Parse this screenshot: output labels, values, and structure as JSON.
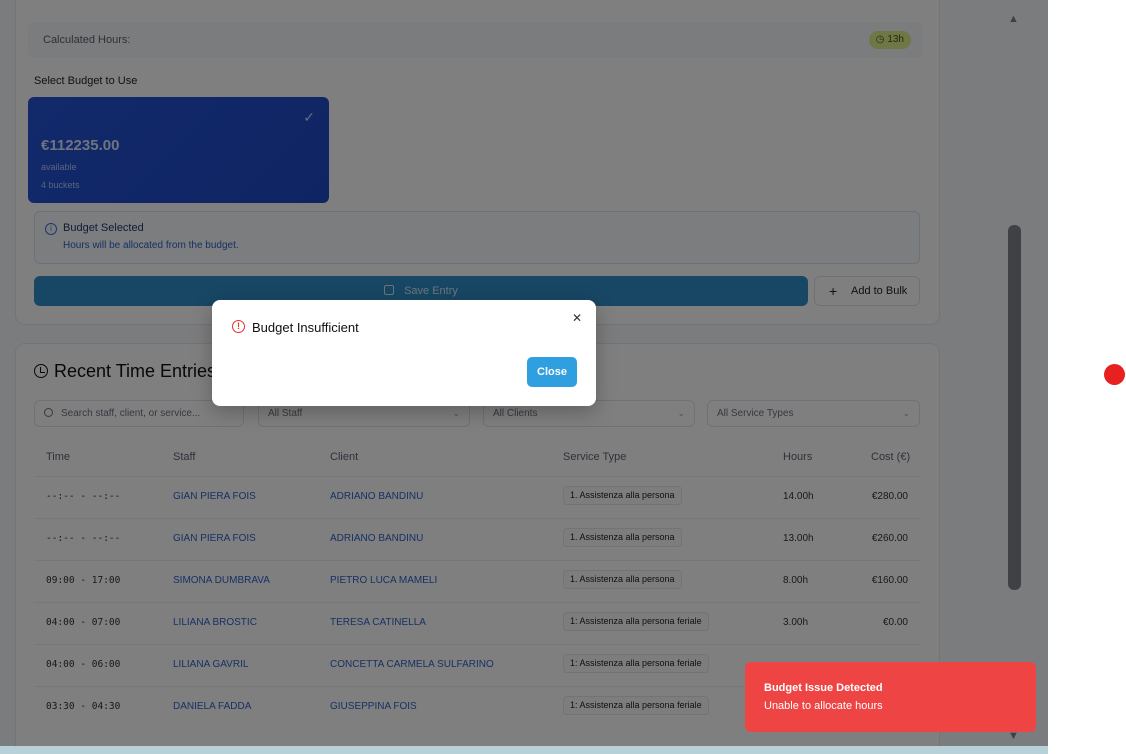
{
  "form": {
    "calculated_hours_label": "Calculated Hours:",
    "calculated_hours_value": "13h",
    "select_budget_label": "Select Budget to Use",
    "budget": {
      "amount": "€112235.00",
      "available": "available",
      "buckets": "4 buckets"
    },
    "info": {
      "title": "Budget Selected",
      "subtitle": "Hours will be allocated from the budget."
    },
    "save_label": "Save Entry",
    "bulk_label": "Add to Bulk"
  },
  "entries": {
    "title": "Recent Time Entries",
    "search_placeholder": "Search staff, client, or service...",
    "filters": {
      "staff": "All Staff",
      "clients": "All Clients",
      "service_types": "All Service Types"
    },
    "columns": {
      "time": "Time",
      "staff": "Staff",
      "client": "Client",
      "service": "Service Type",
      "hours": "Hours",
      "cost": "Cost (€)"
    },
    "rows": [
      {
        "time": "--:-- - --:--",
        "staff": "GIAN PIERA FOIS",
        "client": "ADRIANO BANDINU",
        "service": "1. Assistenza alla persona",
        "hours": "14.00h",
        "cost": "€280.00"
      },
      {
        "time": "--:-- - --:--",
        "staff": "GIAN PIERA FOIS",
        "client": "ADRIANO BANDINU",
        "service": "1. Assistenza alla persona",
        "hours": "13.00h",
        "cost": "€260.00"
      },
      {
        "time": "09:00 - 17:00",
        "staff": "SIMONA DUMBRAVA",
        "client": "PIETRO LUCA MAMELI",
        "service": "1. Assistenza alla persona",
        "hours": "8.00h",
        "cost": "€160.00"
      },
      {
        "time": "04:00 - 07:00",
        "staff": "LILIANA BROSTIC",
        "client": "TERESA CATINELLA",
        "service": "1: Assistenza alla persona feriale",
        "hours": "3.00h",
        "cost": "€0.00"
      },
      {
        "time": "04:00 - 06:00",
        "staff": "LILIANA GAVRIL",
        "client": "CONCETTA CARMELA SULFARINO",
        "service": "1: Assistenza alla persona feriale",
        "hours": "",
        "cost": ""
      },
      {
        "time": "03:30 - 04:30",
        "staff": "DANIELA FADDA",
        "client": "GIUSEPPINA FOIS",
        "service": "1: Assistenza alla persona feriale",
        "hours": "",
        "cost": ""
      }
    ]
  },
  "dialog": {
    "title": "Budget Insufficient",
    "close_label": "Close"
  },
  "toast": {
    "title": "Budget Issue Detected",
    "message": "Unable to allocate hours"
  },
  "colors": {
    "accent": "#2f9fdf",
    "danger": "#ef4444",
    "budget_card": "#2453d6"
  }
}
